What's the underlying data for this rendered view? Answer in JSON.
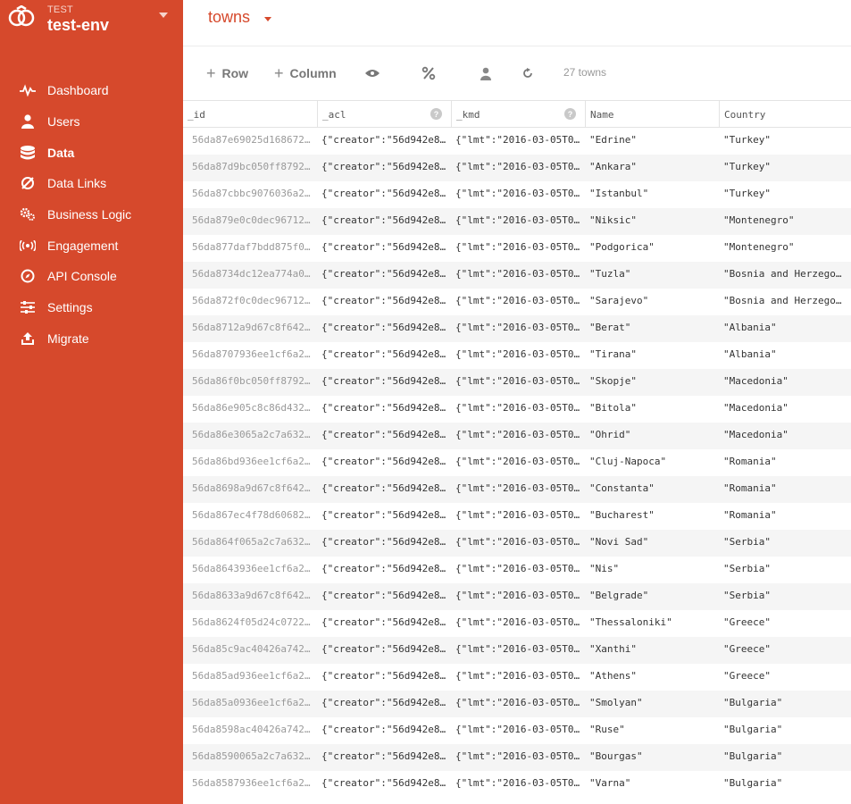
{
  "env": {
    "label_small": "TEST",
    "name": "test-env"
  },
  "nav": [
    {
      "label": "Dashboard",
      "icon": "pulse-icon",
      "active": false
    },
    {
      "label": "Users",
      "icon": "user-icon",
      "active": false
    },
    {
      "label": "Data",
      "icon": "database-icon",
      "active": true
    },
    {
      "label": "Data Links",
      "icon": "link-icon",
      "active": false
    },
    {
      "label": "Business Logic",
      "icon": "gears-icon",
      "active": false
    },
    {
      "label": "Engagement",
      "icon": "broadcast-icon",
      "active": false
    },
    {
      "label": "API Console",
      "icon": "compass-icon",
      "active": false
    },
    {
      "label": "Settings",
      "icon": "sliders-icon",
      "active": false
    },
    {
      "label": "Migrate",
      "icon": "upload-icon",
      "active": false
    }
  ],
  "collection": {
    "name": "towns"
  },
  "toolbar": {
    "add_row": "Row",
    "add_column": "Column",
    "count": "27 towns"
  },
  "columns": [
    "_id",
    "_acl",
    "_kmd",
    "Name",
    "Country"
  ],
  "rows": [
    [
      "56da87e69025d168672…",
      "{\"creator\":\"56d942e8…",
      "{\"lmt\":\"2016-03-05T0…",
      "\"Edrine\"",
      "\"Turkey\""
    ],
    [
      "56da87d9bc050ff8792…",
      "{\"creator\":\"56d942e8…",
      "{\"lmt\":\"2016-03-05T0…",
      "\"Ankara\"",
      "\"Turkey\""
    ],
    [
      "56da87cbbc9076036a2…",
      "{\"creator\":\"56d942e8…",
      "{\"lmt\":\"2016-03-05T0…",
      "\"Istanbul\"",
      "\"Turkey\""
    ],
    [
      "56da879e0c0dec96712…",
      "{\"creator\":\"56d942e8…",
      "{\"lmt\":\"2016-03-05T0…",
      "\"Niksic\"",
      "\"Montenegro\""
    ],
    [
      "56da877daf7bdd875f0…",
      "{\"creator\":\"56d942e8…",
      "{\"lmt\":\"2016-03-05T0…",
      "\"Podgorica\"",
      "\"Montenegro\""
    ],
    [
      "56da8734dc12ea774a0…",
      "{\"creator\":\"56d942e8…",
      "{\"lmt\":\"2016-03-05T0…",
      "\"Tuzla\"",
      "\"Bosnia and Herzegov…"
    ],
    [
      "56da872f0c0dec96712…",
      "{\"creator\":\"56d942e8…",
      "{\"lmt\":\"2016-03-05T0…",
      "\"Sarajevo\"",
      "\"Bosnia and Herzegov…"
    ],
    [
      "56da8712a9d67c8f642…",
      "{\"creator\":\"56d942e8…",
      "{\"lmt\":\"2016-03-05T0…",
      "\"Berat\"",
      "\"Albania\""
    ],
    [
      "56da8707936ee1cf6a2…",
      "{\"creator\":\"56d942e8…",
      "{\"lmt\":\"2016-03-05T0…",
      "\"Tirana\"",
      "\"Albania\""
    ],
    [
      "56da86f0bc050ff8792…",
      "{\"creator\":\"56d942e8…",
      "{\"lmt\":\"2016-03-05T0…",
      "\"Skopje\"",
      "\"Macedonia\""
    ],
    [
      "56da86e905c8c86d432…",
      "{\"creator\":\"56d942e8…",
      "{\"lmt\":\"2016-03-05T0…",
      "\"Bitola\"",
      "\"Macedonia\""
    ],
    [
      "56da86e3065a2c7a632…",
      "{\"creator\":\"56d942e8…",
      "{\"lmt\":\"2016-03-05T0…",
      "\"Ohrid\"",
      "\"Macedonia\""
    ],
    [
      "56da86bd936ee1cf6a2…",
      "{\"creator\":\"56d942e8…",
      "{\"lmt\":\"2016-03-05T0…",
      "\"Cluj-Napoca\"",
      "\"Romania\""
    ],
    [
      "56da8698a9d67c8f642…",
      "{\"creator\":\"56d942e8…",
      "{\"lmt\":\"2016-03-05T0…",
      "\"Constanta\"",
      "\"Romania\""
    ],
    [
      "56da867ec4f78d60682…",
      "{\"creator\":\"56d942e8…",
      "{\"lmt\":\"2016-03-05T0…",
      "\"Bucharest\"",
      "\"Romania\""
    ],
    [
      "56da864f065a2c7a632…",
      "{\"creator\":\"56d942e8…",
      "{\"lmt\":\"2016-03-05T0…",
      "\"Novi Sad\"",
      "\"Serbia\""
    ],
    [
      "56da8643936ee1cf6a2…",
      "{\"creator\":\"56d942e8…",
      "{\"lmt\":\"2016-03-05T0…",
      "\"Nis\"",
      "\"Serbia\""
    ],
    [
      "56da8633a9d67c8f642…",
      "{\"creator\":\"56d942e8…",
      "{\"lmt\":\"2016-03-05T0…",
      "\"Belgrade\"",
      "\"Serbia\""
    ],
    [
      "56da8624f05d24c0722…",
      "{\"creator\":\"56d942e8…",
      "{\"lmt\":\"2016-03-05T0…",
      "\"Thessaloniki\"",
      "\"Greece\""
    ],
    [
      "56da85c9ac40426a742…",
      "{\"creator\":\"56d942e8…",
      "{\"lmt\":\"2016-03-05T0…",
      "\"Xanthi\"",
      "\"Greece\""
    ],
    [
      "56da85ad936ee1cf6a2…",
      "{\"creator\":\"56d942e8…",
      "{\"lmt\":\"2016-03-05T0…",
      "\"Athens\"",
      "\"Greece\""
    ],
    [
      "56da85a0936ee1cf6a2…",
      "{\"creator\":\"56d942e8…",
      "{\"lmt\":\"2016-03-05T0…",
      "\"Smolyan\"",
      "\"Bulgaria\""
    ],
    [
      "56da8598ac40426a742…",
      "{\"creator\":\"56d942e8…",
      "{\"lmt\":\"2016-03-05T0…",
      "\"Ruse\"",
      "\"Bulgaria\""
    ],
    [
      "56da8590065a2c7a632…",
      "{\"creator\":\"56d942e8…",
      "{\"lmt\":\"2016-03-05T0…",
      "\"Bourgas\"",
      "\"Bulgaria\""
    ],
    [
      "56da8587936ee1cf6a2…",
      "{\"creator\":\"56d942e8…",
      "{\"lmt\":\"2016-03-05T0…",
      "\"Varna\"",
      "\"Bulgaria\""
    ]
  ],
  "colors": {
    "accent": "#d6492c",
    "sidebar_bg": "#d6492c",
    "row_alt": "#f5f5f5"
  }
}
